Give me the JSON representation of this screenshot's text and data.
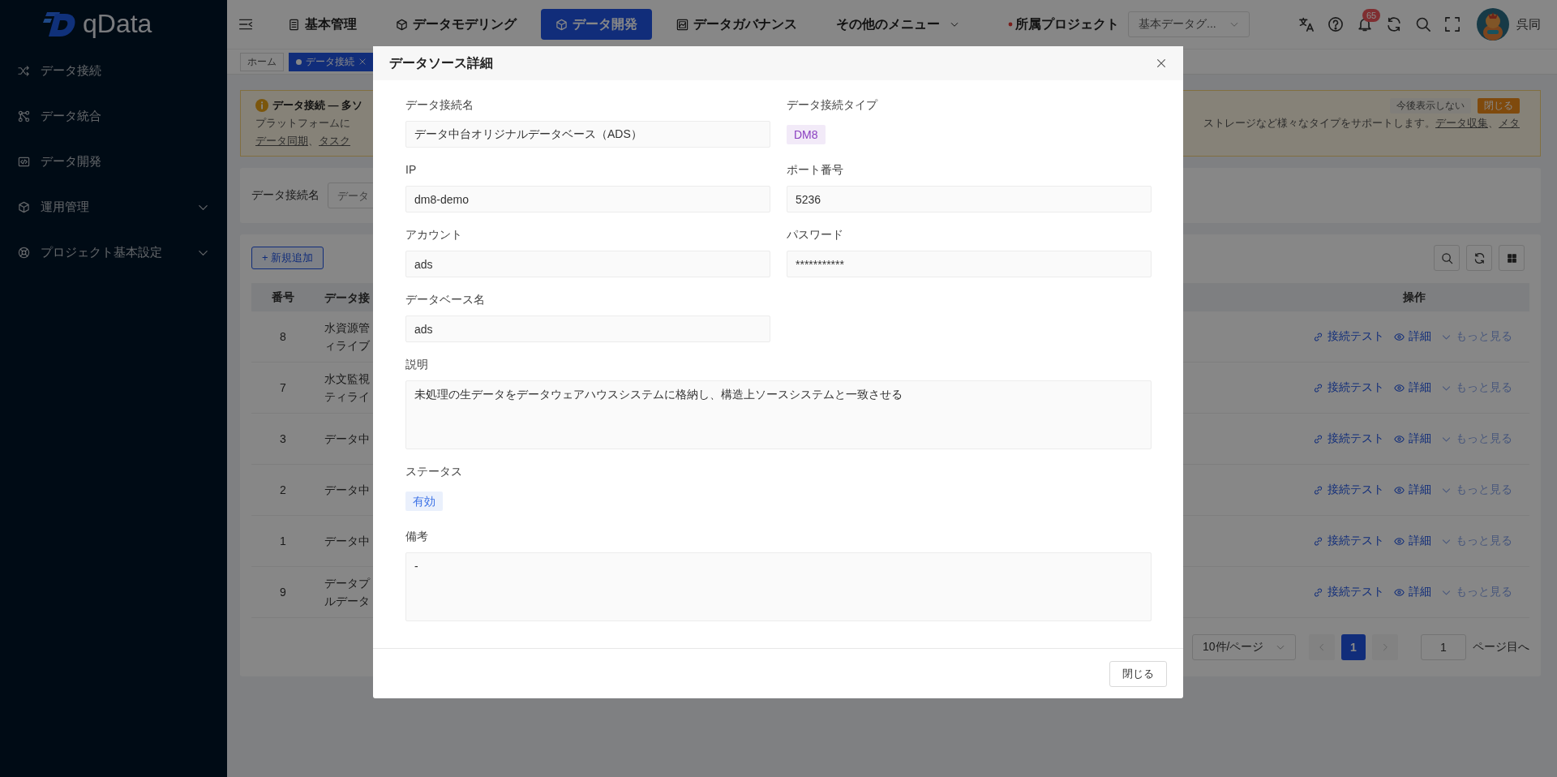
{
  "sidebar": {
    "logo_text": "qData",
    "items": [
      {
        "label": "データ接続",
        "expandable": false
      },
      {
        "label": "データ統合",
        "expandable": false
      },
      {
        "label": "データ開発",
        "expandable": false
      },
      {
        "label": "運用管理",
        "expandable": true
      },
      {
        "label": "プロジェクト基本設定",
        "expandable": true
      }
    ]
  },
  "header": {
    "menu": [
      {
        "label": "基本管理",
        "selected": false,
        "dropdown": false
      },
      {
        "label": "データモデリング",
        "selected": false,
        "dropdown": false
      },
      {
        "label": "データ開発",
        "selected": true,
        "dropdown": false
      },
      {
        "label": "データガバナンス",
        "selected": false,
        "dropdown": false
      },
      {
        "label": "その他のメニュー",
        "selected": false,
        "dropdown": true
      }
    ],
    "project_label": "所属プロジェクト",
    "project_required": true,
    "project_select": "基本データグ...",
    "notification_count": "65",
    "user_name": "呉同"
  },
  "tabs": [
    {
      "label": "ホーム",
      "selected": false,
      "closable": false
    },
    {
      "label": "データ接続",
      "selected": true,
      "closable": true
    }
  ],
  "notice": {
    "title": "データ接続 — 多ソ",
    "left_lines": [
      [
        {
          "text": "プラットフォームに",
          "link": false
        }
      ],
      [
        {
          "text": "データ同期",
          "link": true
        },
        {
          "text": "、",
          "link": false
        },
        {
          "text": "タスク",
          "link": true
        }
      ]
    ],
    "right_line": [
      {
        "text": "ストレージなど様々なタイプをサポートします。",
        "link": false
      },
      {
        "text": "データ収集",
        "link": true
      },
      {
        "text": "、",
        "link": false
      },
      {
        "text": "メタ",
        "link": true
      }
    ],
    "buttons": [
      {
        "label": "今後表示しない",
        "kind": "plain"
      },
      {
        "label": "閉じる",
        "kind": "primary"
      }
    ]
  },
  "filter": {
    "label": "データ接続名",
    "placeholder": "データ"
  },
  "table": {
    "add_button": "+ 新規追加",
    "columns": [
      "番号",
      "データ接",
      "操作"
    ],
    "rows": [
      {
        "number": "8",
        "name_lines": [
          "水資源管",
          "ィライブ"
        ],
        "actions": [
          "接続テスト",
          "詳細",
          "もっと見る"
        ]
      },
      {
        "number": "7",
        "name_lines": [
          "水文監視",
          "ティライ"
        ],
        "actions": [
          "接続テスト",
          "詳細",
          "もっと見る"
        ]
      },
      {
        "number": "3",
        "name_lines": [
          "データ中"
        ],
        "actions": [
          "接続テスト",
          "詳細",
          "もっと見る"
        ]
      },
      {
        "number": "2",
        "name_lines": [
          "データ中"
        ],
        "actions": [
          "接続テスト",
          "詳細",
          "もっと見る"
        ]
      },
      {
        "number": "1",
        "name_lines": [
          "データ中"
        ],
        "actions": [
          "接続テスト",
          "詳細",
          "もっと見る"
        ]
      },
      {
        "number": "9",
        "name_lines": [
          "データプ",
          "ルデータ"
        ],
        "actions": [
          "接続テスト",
          "詳細",
          "もっと見る"
        ]
      }
    ]
  },
  "pagination": {
    "page_size": "10件/ページ",
    "prev_disabled": true,
    "pages": [
      {
        "label": "1",
        "selected": true
      }
    ],
    "next_disabled": true,
    "jump_value": "1",
    "jump_suffix": "ページ目へ"
  },
  "modal": {
    "title": "データソース詳細",
    "fields": [
      {
        "label": "データ接続名",
        "kind": "input",
        "value": "データ中台オリジナルデータベース（ADS）"
      },
      {
        "label": "データ接続タイプ",
        "kind": "tag",
        "value": "DM8",
        "color": "#8a3fc0"
      },
      {
        "label": "IP",
        "kind": "input",
        "value": "dm8-demo"
      },
      {
        "label": "ポート番号",
        "kind": "input",
        "value": "5236"
      },
      {
        "label": "アカウント",
        "kind": "input",
        "value": "ads"
      },
      {
        "label": "パスワード",
        "kind": "input",
        "value": "***********"
      },
      {
        "label": "データベース名",
        "kind": "input",
        "value": "ads"
      },
      {
        "label": "説明",
        "kind": "textarea",
        "value": "未処理の生データをデータウェアハウスシステムに格納し、構造上ソースシステムと一致させる"
      },
      {
        "label": "ステータス",
        "kind": "tag",
        "value": "有効",
        "color": "#3c72e6"
      },
      {
        "label": "備考",
        "kind": "textarea",
        "value": "-"
      }
    ],
    "footer_button": "閉じる"
  }
}
